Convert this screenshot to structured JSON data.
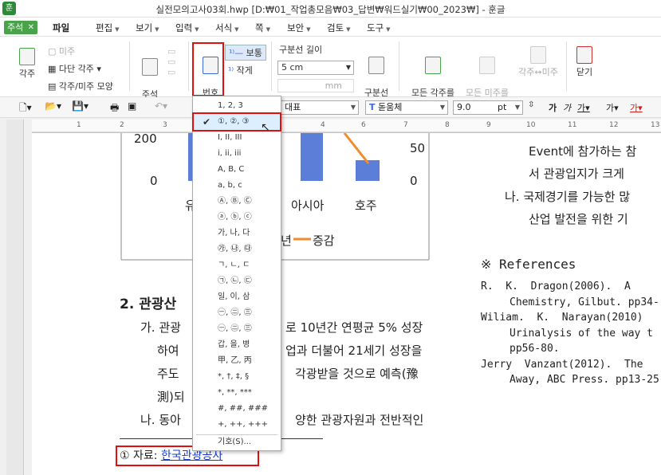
{
  "window": {
    "title": "실전모의고사03회.hwp [D:₩01_작업총모음₩03_답변₩워드실기₩00_2023₩] - 훈글",
    "app_icon": "훈"
  },
  "menubar": {
    "annotation_tab": "주석",
    "file": "파일",
    "items": [
      "편집",
      "보기",
      "입력",
      "서식",
      "쪽",
      "보안",
      "검토",
      "도구"
    ]
  },
  "ribbon": {
    "footnote": "각주",
    "footnote_sub": "미주",
    "multi_col_footnote": "다단 각주",
    "fn_shape": "각주/미주 모양",
    "delete": "주석\n지우기",
    "number_shape": "번호\n모양",
    "normal": "보통",
    "small": "작게",
    "sep_length_label": "구분선 길이",
    "sep_length_value": "5 cm",
    "sep_unit": "mm",
    "sep_style": "구분선\n스타일",
    "all_to_endnote": "모든 각주를\n미주로",
    "all_to_footnote": "모든 미주를\n각주로",
    "swap": "각주↔미주",
    "close": "닫기"
  },
  "toolbar": {
    "style": "대표",
    "font": "돋움체",
    "size": "9.0",
    "unit": "pt"
  },
  "ruler_ticks": [
    "1",
    "2",
    "3",
    "4",
    "5",
    "6",
    "7",
    "8",
    "9",
    "10",
    "11",
    "12",
    "13"
  ],
  "dropdown": {
    "items": [
      "1, 2, 3",
      "①, ②, ③",
      "I, II, III",
      "i, ii, iii",
      "A, B, C",
      "a, b, c",
      "Ⓐ, Ⓑ, Ⓒ",
      "ⓐ, ⓑ, ⓒ",
      "가, 나, 다",
      "㉮, ㉯, ㉰",
      "ㄱ, ㄴ, ㄷ",
      "㉠, ㉡, ㉢",
      "일, 이, 삼",
      "㊀, ㊁, ㊂",
      "㊀, ㊁, ㊂",
      "갑, 을, 병",
      "甲, 乙, 丙",
      "*, †, ‡, §",
      "*, **, ***",
      "#, ##, ###",
      "+, ++, +++"
    ],
    "more": "기호(S)..."
  },
  "chart": {
    "y_left_top": "200",
    "y_left_zero": "0",
    "y_right_top": "50",
    "y_right_zero": "0",
    "cat_partial": "유",
    "cat_asia": "아시아",
    "cat_oceania": "호주",
    "legend_year": "년",
    "legend_change": "증감"
  },
  "doc": {
    "heading": "2. 관광산",
    "ga_line1a": "가. 관광",
    "ga_line1b": "로 10년간 연평균 5% 성장",
    "ga_line2a": "하여",
    "ga_line2b": "업과 더불어 21세기 성장을",
    "ga_line3a": "주도",
    "ga_line3b": "각광받을 것으로 예측(豫",
    "ga_line4": "測)되",
    "na_line1a": "나. 동아",
    "na_line1b": "양한 관광자원과 전반적인",
    "footnote_num": "①",
    "footnote_text": "자료: ",
    "footnote_link": "한국관광공사",
    "right_l1": "Event에 참가하는 참",
    "right_l2": "서 관광입지가 크게",
    "right_l3": "나. 국제경기를 가능한 많",
    "right_l4": "산업 발전을 위한 기",
    "refs_title": "※ References",
    "ref1a": "R.  K.  Dragon(2006).  A",
    "ref1b": "Chemistry, Gilbut. pp34-",
    "ref2a": "Wiliam.  K.  Narayan(2010)",
    "ref2b": "Urinalysis of the way t",
    "ref2c": "pp56-80.",
    "ref3a": "Jerry  Vanzant(2012).  The",
    "ref3b": "Away, ABC Press. pp13-25"
  },
  "colors": {
    "bar": "#5b7fd8",
    "line": "#f08c2c",
    "redbox": "#e01010",
    "link": "#1a3cc8"
  }
}
